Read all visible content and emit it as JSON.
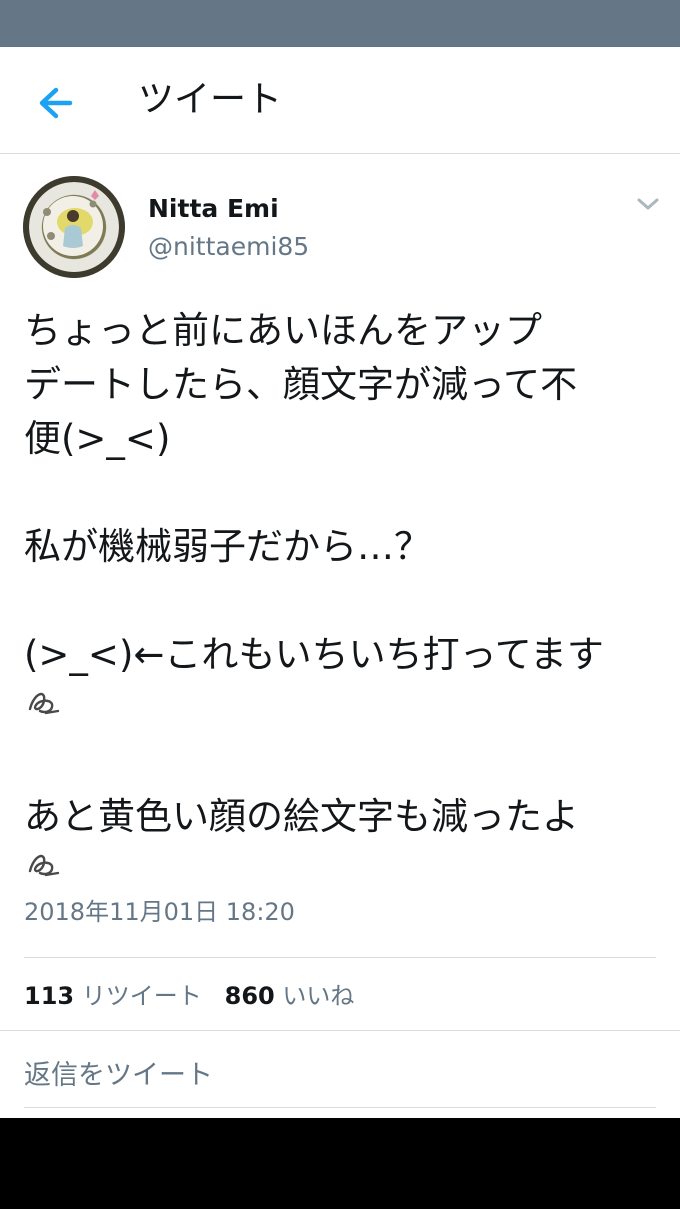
{
  "header": {
    "title": "ツイート",
    "back_icon": "arrow-left-icon",
    "accent_color": "#1da1f2"
  },
  "tweet": {
    "author": {
      "display_name": "Nitta Emi",
      "handle": "@nittaemi85",
      "avatar_icon": "avatar"
    },
    "caret_icon": "chevron-down-icon",
    "body": {
      "line1": "ちょっと前にあいほんをアップ",
      "line2": "デートしたら、顔文字が減って不",
      "line3": "便(>_<)",
      "line4": "私が機械弱子だから…？",
      "line5": "(>_<)←これもいちいち打ってます",
      "line6": "あと黄色い顔の絵文字も減ったよ",
      "emoji_icon": "squiggle-emoji-icon"
    },
    "timestamp": "2018年11月01日 18:20",
    "stats": {
      "retweet_count": "113",
      "retweet_label": "リツイート",
      "like_count": "860",
      "like_label": "いいね"
    },
    "reply_placeholder": "返信をツイート"
  }
}
